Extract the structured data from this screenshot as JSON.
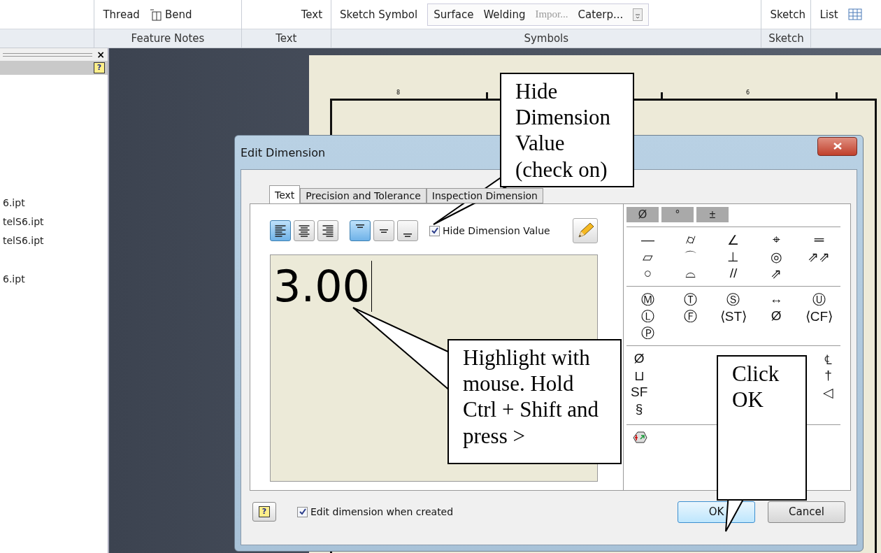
{
  "ribbon": {
    "groups": [
      {
        "label": "Feature Notes",
        "tools": [
          {
            "kind": "text",
            "label": "Thread"
          },
          {
            "kind": "icon_text",
            "label": "Bend"
          }
        ]
      },
      {
        "label": "Text",
        "tools": [
          {
            "kind": "text",
            "label": "Text"
          }
        ]
      },
      {
        "label": "Symbols",
        "tools": [
          {
            "kind": "text",
            "label": "Sketch Symbol"
          },
          {
            "kind": "gallery",
            "items": [
              {
                "label": "Surface",
                "disabled": false
              },
              {
                "label": "Welding",
                "disabled": false
              },
              {
                "label": "Impor...",
                "disabled": true
              },
              {
                "label": "Caterp...",
                "disabled": false
              }
            ]
          }
        ]
      },
      {
        "label": "Sketch",
        "tools": [
          {
            "kind": "text",
            "label": "Sketch"
          }
        ]
      },
      {
        "tools": [
          {
            "kind": "text",
            "label": "List"
          },
          {
            "kind": "icon"
          }
        ]
      }
    ]
  },
  "browser": {
    "close": "×",
    "help": "?",
    "items": [
      {
        "label": "6.ipt"
      },
      {
        "label": "telS6.ipt"
      },
      {
        "label": "telS6.ipt"
      },
      {
        "label": "6.ipt"
      }
    ]
  },
  "sheet": {
    "ruler_labels": [
      "8",
      "6"
    ]
  },
  "dialog": {
    "title": "Edit Dimension",
    "tabs": [
      {
        "label": "Text",
        "selected": true
      },
      {
        "label": "Precision and Tolerance",
        "selected": false
      },
      {
        "label": "Inspection Dimension",
        "selected": false
      }
    ],
    "h_align": [
      {
        "selected": true
      },
      {
        "selected": false
      },
      {
        "selected": false
      }
    ],
    "v_align": [
      {
        "selected": true
      },
      {
        "selected": false
      },
      {
        "selected": false
      }
    ],
    "hide_value": {
      "label": "Hide Dimension Value",
      "checked": true
    },
    "value": "3.00",
    "palette": {
      "top": [
        "Ø",
        "°",
        "±"
      ],
      "grid_1": [
        "—",
        "⌭",
        "∠",
        "⌖",
        "═",
        "▱",
        "⌒",
        "⊥",
        "◎",
        "⇗⇗",
        "○",
        "⌓",
        "//",
        "⇗"
      ],
      "grid_2": [
        "Ⓜ",
        "Ⓣ",
        "Ⓢ",
        "↔",
        "Ⓤ",
        "Ⓛ",
        "Ⓕ",
        "⟨ST⟩",
        "Ø",
        "⟨CF⟩",
        "Ⓟ"
      ],
      "grid_3_left": [
        "Ø",
        "⊔",
        "SF",
        "§"
      ],
      "grid_3_right": [
        "℄",
        "†",
        "◁"
      ]
    },
    "help": "?",
    "edit_when_created": {
      "label": "Edit dimension when created",
      "checked": true
    },
    "buttons": [
      {
        "label": "OK",
        "default": true
      },
      {
        "label": "Cancel",
        "default": false
      }
    ]
  },
  "callouts": [
    {
      "text": "Hide Dimension Value (check on)"
    },
    {
      "text": "Highlight with mouse. Hold Ctrl + Shift and press >"
    },
    {
      "text": "Click OK"
    }
  ]
}
